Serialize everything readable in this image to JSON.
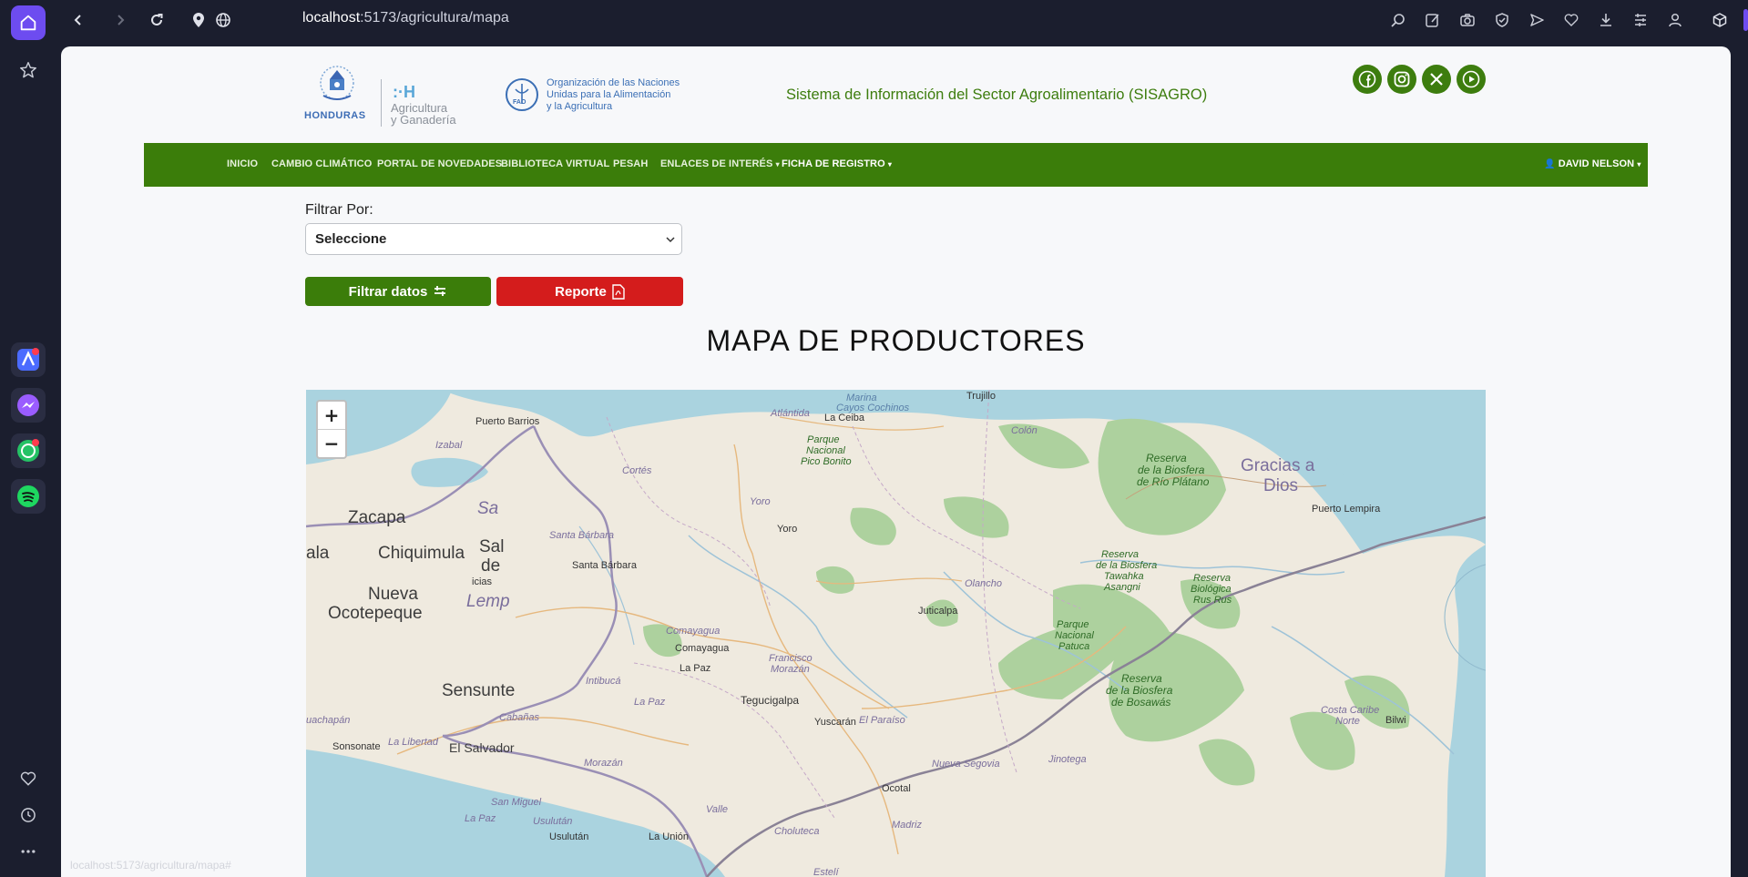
{
  "browser": {
    "url_host": "localhost",
    "url_path": ":5173/agricultura/mapa",
    "status_url": "localhost:5173/agricultura/mapa#"
  },
  "header": {
    "honduras_logo": "HONDURAS",
    "sag_logo_line1": "Agricultura",
    "sag_logo_line2": "y Ganadería",
    "fao_line1": "Organización de las Naciones",
    "fao_line2": "Unidas para la Alimentación",
    "fao_line3": "y la Agricultura",
    "fao_emblem_text": "FAO",
    "title": "Sistema de Información del Sector Agroalimentario (SISAGRO)",
    "social_icons": [
      "facebook-icon",
      "instagram-icon",
      "x-icon",
      "youtube-icon"
    ]
  },
  "nav": {
    "items": [
      "INICIO",
      "CAMBIO CLIMÁTICO",
      "PORTAL DE NOVEDADES",
      "BIBLIOTECA VIRTUAL",
      "PESAH",
      "ENLACES DE INTERÉS",
      "FICHA DE REGISTRO"
    ],
    "user": "DAVID NELSON"
  },
  "filter": {
    "label": "Filtrar Por:",
    "selected": "Seleccione",
    "filter_button": "Filtrar datos",
    "report_button": "Reporte"
  },
  "map": {
    "title": "MAPA DE PRODUCTORES",
    "zoom_in": "+",
    "zoom_out": "−",
    "labels": {
      "puerto_barrios": "Puerto Barrios",
      "izabal": "Izabal",
      "zacapa": "Zacapa",
      "chiquimula": "Chiquimula",
      "nueva_ocotepeque_1": "Nueva",
      "nueva_ocotepeque_2": "Ocotepeque",
      "sensuntepeque": "Sensunte",
      "el_salvador": "El Salvador",
      "la_libertad": "La Libertad",
      "sonsonate": "Sonsonate",
      "cabanas": "Cabañas",
      "san_miguel": "San Miguel",
      "usulutan_dep": "Usulután",
      "usulutan": "Usulután",
      "la_union": "La Unión",
      "la_paz_sv": "La Paz",
      "morazan": "Morazán",
      "santa_barbara_dep": "Santa Bárbara",
      "santa_barbara": "Santa Bárbara",
      "cortes": "Cortés",
      "atlantida": "Atlántida",
      "la_ceiba": "La Ceiba",
      "pico_bonito_1": "Parque",
      "pico_bonito_2": "Nacional",
      "pico_bonito_3": "Pico Bonito",
      "marina_1": "Marina",
      "marina_2": "Cayos Cochinos",
      "trujillo": "Trujillo",
      "colon": "Colón",
      "yoro_dep": "Yoro",
      "yoro": "Yoro",
      "comayagua_dep": "Comayagua",
      "comayagua": "Comayagua",
      "intibuca": "Intibucá",
      "la_paz_dep": "La Paz",
      "la_paz": "La Paz",
      "francisco_1": "Francisco",
      "francisco_2": "Morazán",
      "tegucigalpa": "Tegucigalpa",
      "yuscaran": "Yuscarán",
      "el_paraiso": "El Paraíso",
      "valle": "Valle",
      "choluteca": "Choluteca",
      "olancho": "Olancho",
      "juticalpa": "Juticalpa",
      "patuca_1": "Parque",
      "patuca_2": "Nacional",
      "patuca_3": "Patuca",
      "tawahka_1": "Reserva",
      "tawahka_2": "de la Biosfera",
      "tawahka_3": "Tawahka",
      "tawahka_4": "Asangni",
      "rio_platano_1": "Reserva",
      "rio_platano_2": "de la Biosfera",
      "rio_platano_3": "de Río Plátano",
      "rus_rus_1": "Reserva",
      "rus_rus_2": "Biológica",
      "rus_rus_3": "Rus Rus",
      "bosawas_1": "Reserva",
      "bosawas_2": "de la Biosfera",
      "bosawas_3": "de Bosawás",
      "gracias_1": "Gracias a",
      "gracias_2": "Dios",
      "puerto_lempira": "Puerto Lempira",
      "costa_caribe_1": "Costa Caribe",
      "costa_caribe_2": "Norte",
      "bilwi": "Bilwi",
      "nueva_segovia": "Nueva Segovia",
      "ocotal": "Ocotal",
      "madriz": "Madriz",
      "jinotega": "Jinotega",
      "esteli": "Estelí",
      "ahuachapan": "uachapán",
      "guatemala_edge": "ala",
      "lempira_edge": "Lemp",
      "sal_edge": "Sa",
      "sal_edge2": "Sal",
      "de_edge": "de",
      "ia_edge": "icias"
    }
  }
}
